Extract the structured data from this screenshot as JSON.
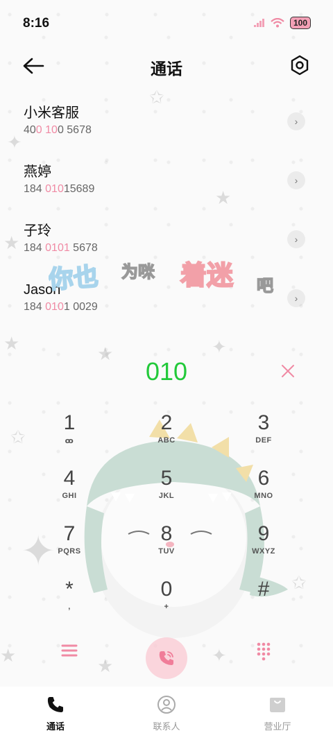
{
  "status_bar": {
    "time": "8:16",
    "battery": "100"
  },
  "header": {
    "title": "通话"
  },
  "contacts": [
    {
      "name": "小米客服",
      "number_parts": [
        "40",
        "0 10",
        "0 5678"
      ]
    },
    {
      "name": "燕婷",
      "number_parts": [
        "184 ",
        "010",
        "15689"
      ]
    },
    {
      "name": "子玲",
      "number_parts": [
        "184 ",
        "0101",
        " 5678"
      ]
    },
    {
      "name": "Jason",
      "number_parts": [
        "184 ",
        "010",
        "1 0029"
      ]
    }
  ],
  "wallpaper_text": [
    "你也",
    "为咪",
    "着迷",
    "吧"
  ],
  "dialer": {
    "input": "010",
    "keys": [
      {
        "digit": "1",
        "letters": "ꝏ"
      },
      {
        "digit": "2",
        "letters": "ABC"
      },
      {
        "digit": "3",
        "letters": "DEF"
      },
      {
        "digit": "4",
        "letters": "GHI"
      },
      {
        "digit": "5",
        "letters": "JKL"
      },
      {
        "digit": "6",
        "letters": "MNO"
      },
      {
        "digit": "7",
        "letters": "PQRS"
      },
      {
        "digit": "8",
        "letters": "TUV"
      },
      {
        "digit": "9",
        "letters": "WXYZ"
      },
      {
        "digit": "*",
        "letters": ","
      },
      {
        "digit": "0",
        "letters": "+"
      },
      {
        "digit": "#",
        "letters": ""
      }
    ]
  },
  "nav": {
    "calls": "通话",
    "contacts": "联系人",
    "service": "营业厅"
  },
  "colors": {
    "accent_pink": "#f08aa4",
    "dial_green": "#22c93a"
  },
  "icons": {
    "back": "arrow-left-icon",
    "settings": "hexagon-gear-icon",
    "chevron": "chevron-right-icon",
    "clear": "close-icon",
    "menu": "menu-icon",
    "call": "phone-icon",
    "keypad": "keypad-icon"
  }
}
